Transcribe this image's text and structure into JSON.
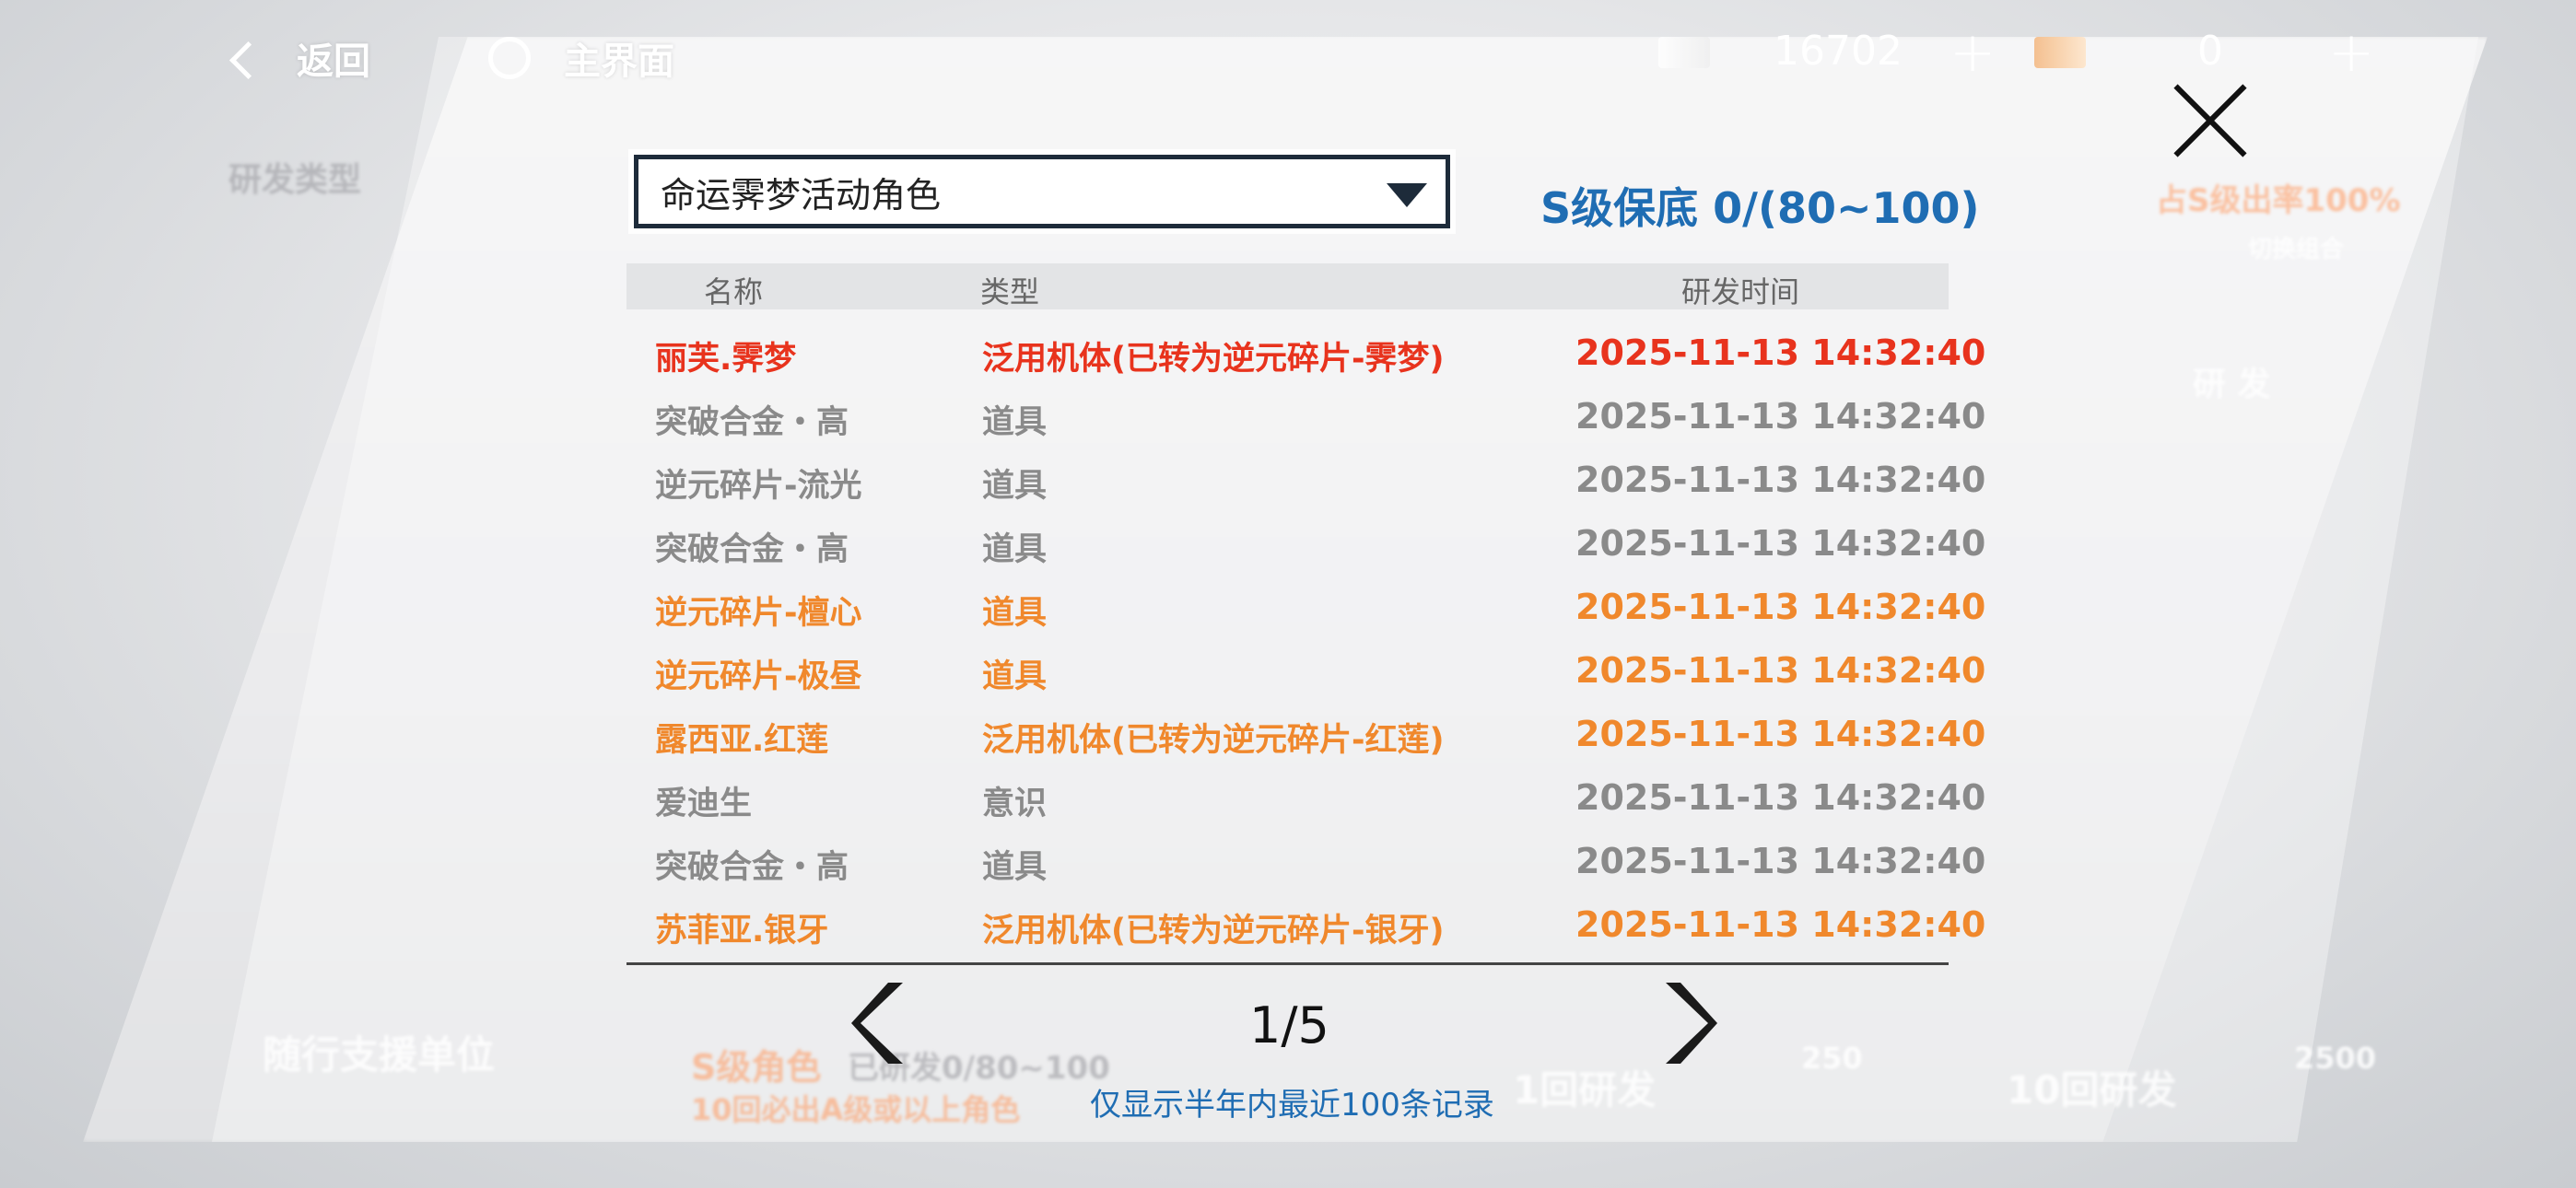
{
  "topbar": {
    "back_label": "返回",
    "home_label": "主界面",
    "currency_1": "16702",
    "currency_2": "0",
    "plus_symbol": "+"
  },
  "background": {
    "category_label": "研发类型",
    "support_unit": "随行支援单位",
    "s_grade": "S级角色",
    "pity_text": "已研发0/80~100",
    "ten_guarantee": "10回必出A级或以上角色",
    "single_draw": "1回研发",
    "single_cost": "250",
    "ten_draw": "10回研发",
    "ten_cost": "2500",
    "rate_text": "占S级出率100%",
    "switch_combo": "切换组合",
    "research_header": "研 发"
  },
  "dropdown": {
    "selected": "命运霁梦活动角色"
  },
  "pity": "S级保底 0/(80~100)",
  "table": {
    "headers": {
      "name": "名称",
      "type": "类型",
      "time": "研发时间"
    },
    "rows": [
      {
        "name": "丽芙.霁梦",
        "type": "泛用机体(已转为逆元碎片-霁梦)",
        "time": "2025-11-13 14:32:40",
        "rarity": "red"
      },
      {
        "name": "突破合金・高",
        "type": "道具",
        "time": "2025-11-13 14:32:40",
        "rarity": "gray"
      },
      {
        "name": "逆元碎片-流光",
        "type": "道具",
        "time": "2025-11-13 14:32:40",
        "rarity": "gray"
      },
      {
        "name": "突破合金・高",
        "type": "道具",
        "time": "2025-11-13 14:32:40",
        "rarity": "gray"
      },
      {
        "name": "逆元碎片-檀心",
        "type": "道具",
        "time": "2025-11-13 14:32:40",
        "rarity": "orange"
      },
      {
        "name": "逆元碎片-极昼",
        "type": "道具",
        "time": "2025-11-13 14:32:40",
        "rarity": "orange"
      },
      {
        "name": "露西亚.红莲",
        "type": "泛用机体(已转为逆元碎片-红莲)",
        "time": "2025-11-13 14:32:40",
        "rarity": "orange"
      },
      {
        "name": "爱迪生",
        "type": "意识",
        "time": "2025-11-13 14:32:40",
        "rarity": "gray"
      },
      {
        "name": "突破合金・高",
        "type": "道具",
        "time": "2025-11-13 14:32:40",
        "rarity": "gray"
      },
      {
        "name": "苏菲亚.银牙",
        "type": "泛用机体(已转为逆元碎片-银牙)",
        "time": "2025-11-13 14:32:40",
        "rarity": "orange"
      }
    ]
  },
  "pager": {
    "indicator": "1/5"
  },
  "note": "仅显示半年内最近100条记录",
  "colors": {
    "red": "#e8331d",
    "orange": "#f0882c",
    "gray": "#8a8a8a",
    "accent": "#1f6db3"
  }
}
